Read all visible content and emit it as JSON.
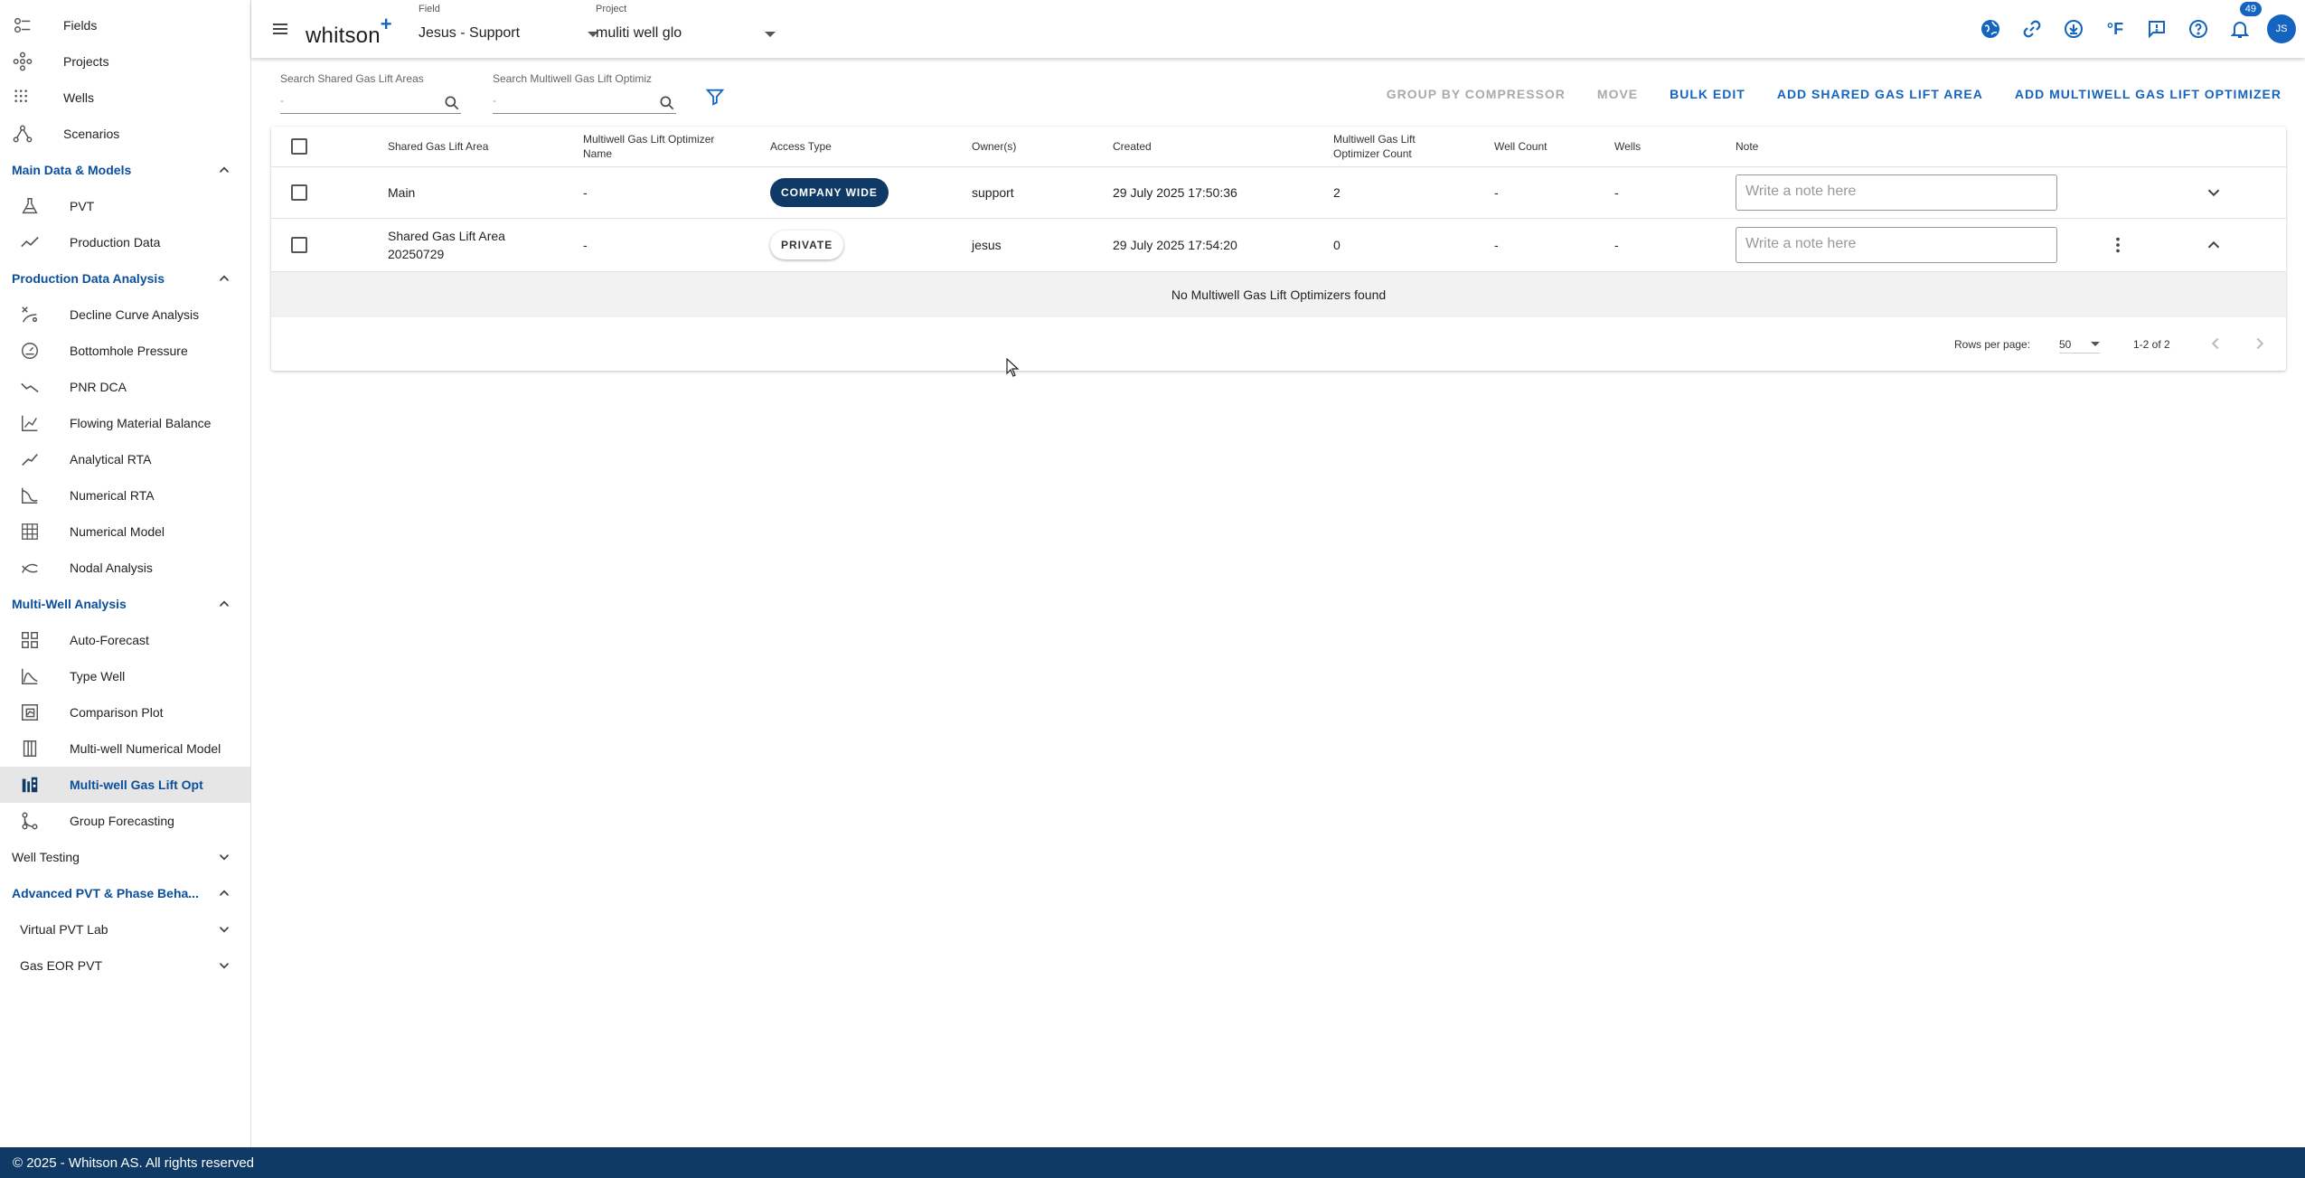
{
  "sidebar": {
    "top_items": [
      {
        "label": "Fields",
        "icon": "fields-icon"
      },
      {
        "label": "Projects",
        "icon": "projects-icon"
      },
      {
        "label": "Wells",
        "icon": "wells-icon"
      },
      {
        "label": "Scenarios",
        "icon": "scenarios-icon"
      }
    ],
    "sections": {
      "main_data": "Main Data & Models",
      "pda": "Production Data Analysis",
      "mwa": "Multi-Well Analysis",
      "well_testing": "Well Testing",
      "adv_pvt": "Advanced PVT & Phase Beha...",
      "virtual_pvt": "Virtual PVT Lab",
      "gas_eor": "Gas EOR PVT"
    },
    "main_data_items": [
      {
        "label": "PVT",
        "icon": "flask-icon"
      },
      {
        "label": "Production Data",
        "icon": "trend-icon"
      }
    ],
    "pda_items": [
      {
        "label": "Decline Curve Analysis",
        "icon": "decline-icon"
      },
      {
        "label": "Bottomhole Pressure",
        "icon": "gauge-icon"
      },
      {
        "label": "PNR DCA",
        "icon": "trend-down-icon"
      },
      {
        "label": "Flowing Material Balance",
        "icon": "chart-icon"
      },
      {
        "label": "Analytical RTA",
        "icon": "line-icon"
      },
      {
        "label": "Numerical RTA",
        "icon": "rta-icon"
      },
      {
        "label": "Numerical Model",
        "icon": "grid-icon"
      },
      {
        "label": "Nodal Analysis",
        "icon": "nodal-icon"
      }
    ],
    "mwa_items": [
      {
        "label": "Auto-Forecast",
        "icon": "dashboard-icon"
      },
      {
        "label": "Type Well",
        "icon": "type-well-icon"
      },
      {
        "label": "Comparison Plot",
        "icon": "comparison-icon"
      },
      {
        "label": "Multi-well Numerical Model",
        "icon": "columns-icon"
      },
      {
        "label": "Multi-well Gas Lift Opt",
        "icon": "gas-lift-icon"
      },
      {
        "label": "Group Forecasting",
        "icon": "group-icon"
      }
    ]
  },
  "topbar": {
    "logo": "whitson",
    "logo_plus": "+",
    "field_label": "Field",
    "field_value": "Jesus - Support",
    "project_label": "Project",
    "project_value": "muliti well glo",
    "temp_unit": "°F",
    "notifications": "49",
    "avatar": "JS"
  },
  "search": {
    "shared_label": "Search Shared Gas Lift Areas",
    "shared_value": "-",
    "mw_label": "Search Multiwell Gas Lift Optimiz",
    "mw_value": "-"
  },
  "actions": {
    "group": "GROUP BY COMPRESSOR",
    "move": "MOVE",
    "bulk": "BULK EDIT",
    "add_area": "ADD SHARED GAS LIFT AREA",
    "add_opt": "ADD MULTIWELL GAS LIFT OPTIMIZER"
  },
  "table": {
    "headers": {
      "area": "Shared Gas Lift Area",
      "opt_name": "Multiwell Gas Lift Optimizer Name",
      "access": "Access Type",
      "owners": "Owner(s)",
      "created": "Created",
      "opt_count": "Multiwell Gas Lift Optimizer Count",
      "well_count": "Well Count",
      "wells": "Wells",
      "note": "Note"
    },
    "rows": [
      {
        "area": "Main",
        "opt_name": "-",
        "access": "COMPANY WIDE",
        "owner": "support",
        "created": "29 July 2025 17:50:36",
        "opt_count": "2",
        "well_count": "-",
        "wells": "-",
        "note_placeholder": "Write a note here"
      },
      {
        "area": "Shared Gas Lift Area 20250729",
        "opt_name": "-",
        "access": "PRIVATE",
        "owner": "jesus",
        "created": "29 July 2025 17:54:20",
        "opt_count": "0",
        "well_count": "-",
        "wells": "-",
        "note_placeholder": "Write a note here"
      }
    ],
    "empty": "No Multiwell Gas Lift Optimizers found"
  },
  "pagination": {
    "rows_label": "Rows per page:",
    "rows_value": "50",
    "range": "1-2 of 2"
  },
  "footer": "© 2025 - Whitson AS. All rights reserved",
  "colors": {
    "accent": "#1565c0",
    "navy": "#0f3a66",
    "section": "#0b4f9c"
  }
}
